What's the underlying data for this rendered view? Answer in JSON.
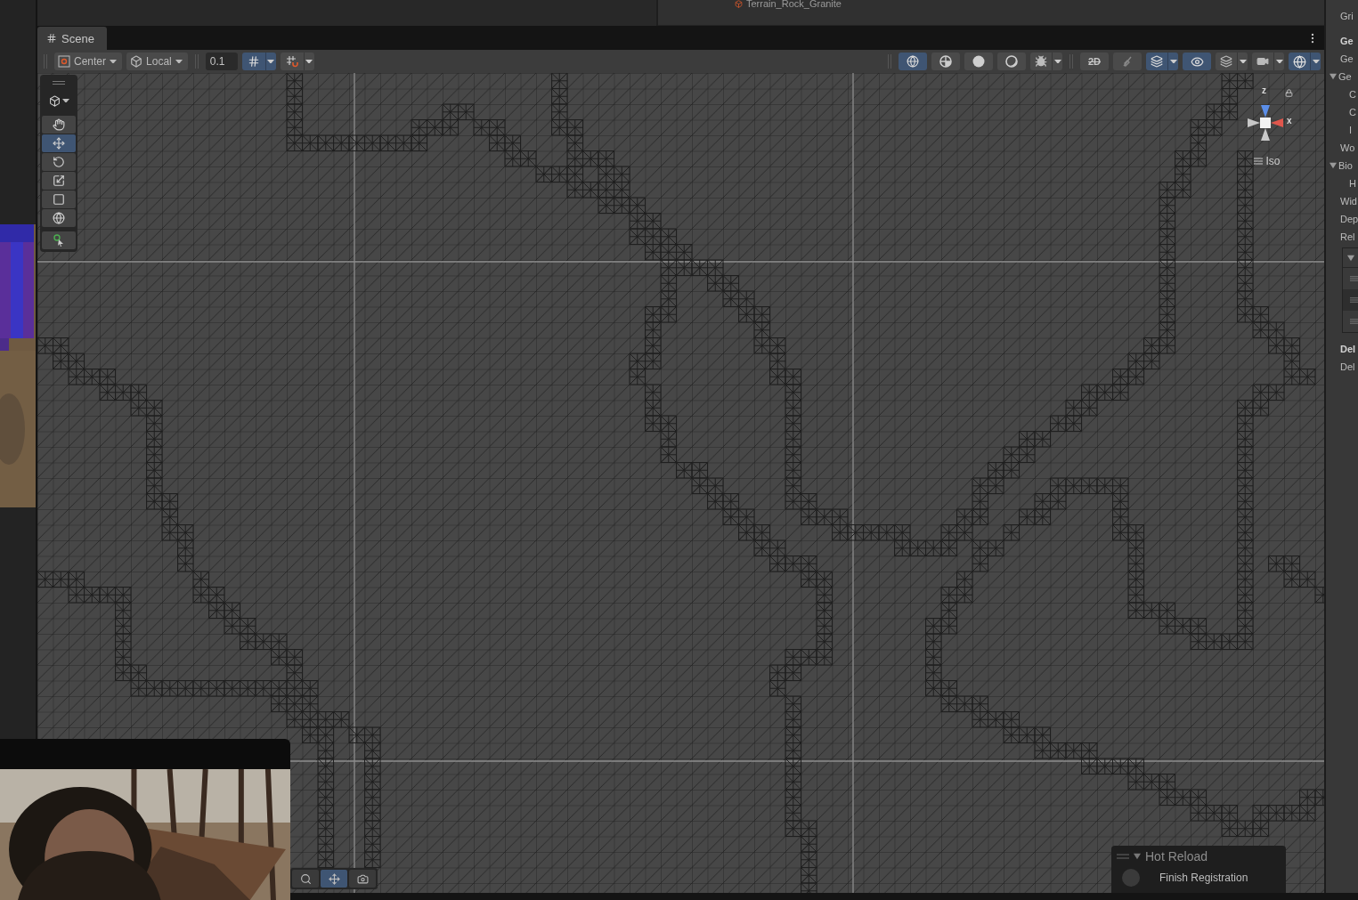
{
  "top_panel": {
    "asset_label": "Terrain_Rock_Granite"
  },
  "scene_tab": {
    "label": "Scene",
    "selected": true
  },
  "toolbar": {
    "pivot": "Center",
    "space": "Local",
    "snap_value": "0.1",
    "snap_buttons": [
      {
        "kind": "grid-snap",
        "selected": true,
        "dropdown": true
      },
      {
        "kind": "increment-snap",
        "selected": false,
        "dropdown": true
      }
    ],
    "view_buttons": [
      {
        "kind": "wire-globe",
        "selected": true,
        "dropdown": false,
        "separator_before": true
      },
      {
        "kind": "shaded-wire",
        "selected": false,
        "dropdown": false,
        "separator_before": false
      },
      {
        "kind": "solid",
        "selected": false,
        "dropdown": false,
        "separator_before": false
      },
      {
        "kind": "moon",
        "selected": false,
        "dropdown": false,
        "separator_before": false
      },
      {
        "kind": "bug",
        "selected": false,
        "dropdown": true,
        "separator_before": false
      },
      {
        "kind": "two-d",
        "label": "2D",
        "selected": false,
        "dropdown": false,
        "separator_before": true
      },
      {
        "kind": "lighting",
        "selected": false,
        "dropdown": false,
        "separator_before": false
      },
      {
        "kind": "effects",
        "selected": true,
        "dropdown": true,
        "separator_before": false
      },
      {
        "kind": "visibility",
        "selected": true,
        "dropdown": false,
        "separator_before": false
      },
      {
        "kind": "layers",
        "selected": false,
        "dropdown": true,
        "separator_before": false
      },
      {
        "kind": "camera",
        "selected": false,
        "dropdown": true,
        "separator_before": false
      },
      {
        "kind": "gizmos",
        "selected": true,
        "dropdown": true,
        "separator_before": false
      }
    ]
  },
  "tools": [
    {
      "kind": "hand",
      "selected": false
    },
    {
      "kind": "move",
      "selected": true
    },
    {
      "kind": "rotate",
      "selected": false
    },
    {
      "kind": "scale",
      "selected": false
    },
    {
      "kind": "rect",
      "selected": false
    },
    {
      "kind": "transform",
      "selected": false
    },
    {
      "kind": "custom",
      "selected": false
    }
  ],
  "orientation_gizmo": {
    "axis_labels": [
      "z",
      "x"
    ],
    "projection": "Iso"
  },
  "overlay_buttons": [
    {
      "kind": "search",
      "selected": false
    },
    {
      "kind": "move",
      "selected": true
    },
    {
      "kind": "camera",
      "selected": false
    }
  ],
  "hot_reload": {
    "title": "Hot Reload",
    "expanded": true,
    "button": "Finish Registration"
  },
  "inspector": {
    "lines": [
      {
        "kind": "label",
        "text": "Gri",
        "bold": false
      },
      {
        "kind": "gap"
      },
      {
        "kind": "label",
        "text": "Ge",
        "bold": true
      },
      {
        "kind": "label",
        "text": "Ge",
        "bold": false
      },
      {
        "kind": "foldout",
        "text": "Ge",
        "expanded": true
      },
      {
        "kind": "child",
        "text": "C"
      },
      {
        "kind": "child",
        "text": "C"
      },
      {
        "kind": "child",
        "text": "I"
      },
      {
        "kind": "label",
        "text": "Wo",
        "bold": false
      },
      {
        "kind": "foldout",
        "text": "Bio",
        "expanded": true
      },
      {
        "kind": "child",
        "text": "H"
      },
      {
        "kind": "label",
        "text": "Wid",
        "bold": false
      },
      {
        "kind": "label",
        "text": "Dep",
        "bold": false
      },
      {
        "kind": "label",
        "text": "Rel",
        "bold": false
      },
      {
        "kind": "list",
        "rows": [
          {
            "kind": "handle"
          },
          {
            "kind": "handle"
          },
          {
            "kind": "handle"
          }
        ],
        "expanded": true
      },
      {
        "kind": "label",
        "text": "Del",
        "bold": true
      },
      {
        "kind": "label",
        "text": "Del",
        "bold": false
      }
    ]
  }
}
